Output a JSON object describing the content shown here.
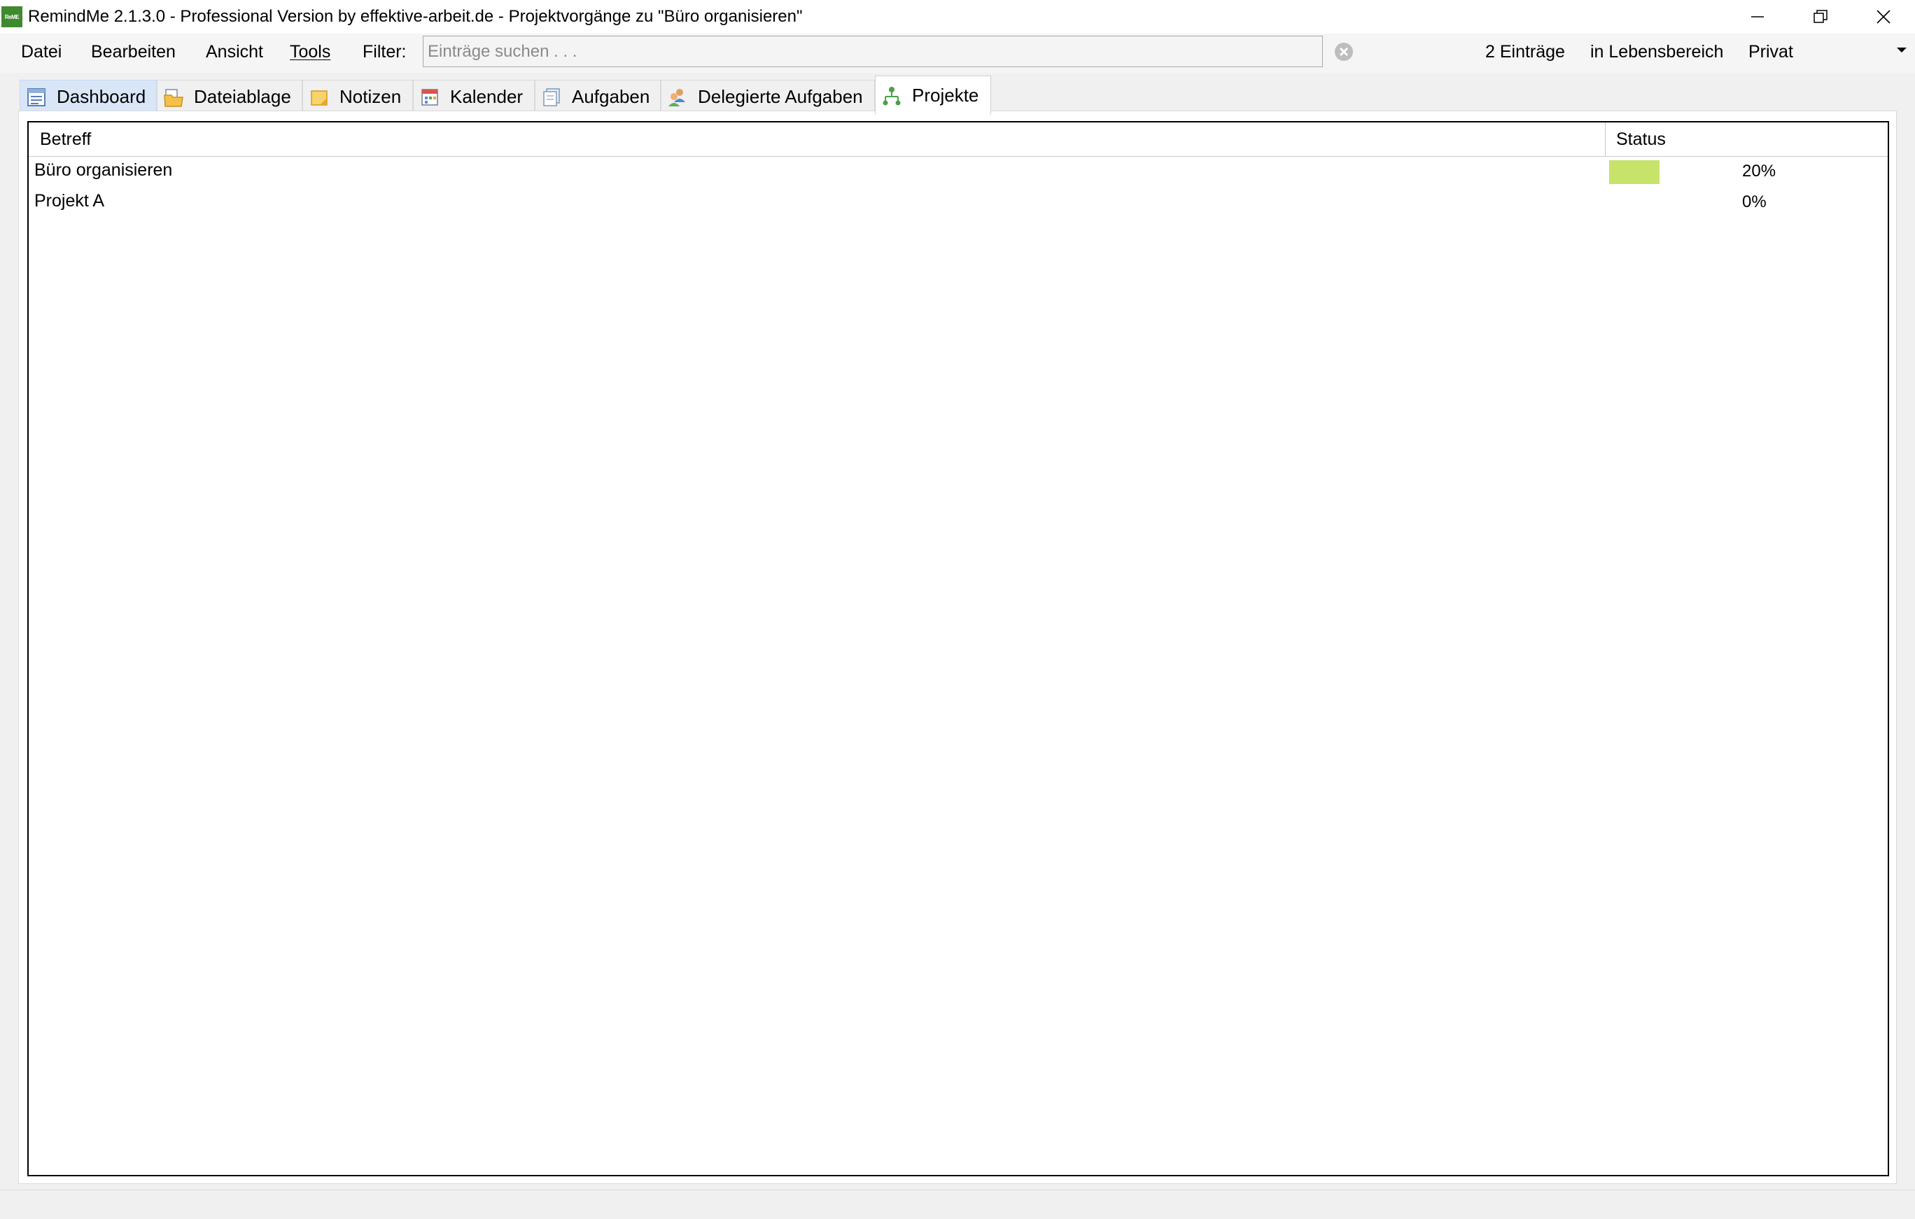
{
  "window": {
    "icon_text": "ReME",
    "title": "RemindMe 2.1.3.0 - Professional Version by effektive-arbeit.de - Projektvorgänge zu \"Büro organisieren\""
  },
  "menu": {
    "items": [
      "Datei",
      "Bearbeiten",
      "Ansicht",
      "Tools"
    ],
    "filter_label": "Filter:",
    "search_placeholder": "Einträge suchen . . .",
    "search_value": ""
  },
  "status": {
    "entries": "2 Einträge",
    "area_label": "in Lebensbereich",
    "area_value": "Privat"
  },
  "tabs": [
    {
      "label": "Dashboard",
      "icon": "dashboard-icon"
    },
    {
      "label": "Dateiablage",
      "icon": "folder-icon"
    },
    {
      "label": "Notizen",
      "icon": "notes-icon"
    },
    {
      "label": "Kalender",
      "icon": "calendar-icon"
    },
    {
      "label": "Aufgaben",
      "icon": "tasks-icon"
    },
    {
      "label": "Delegierte Aufgaben",
      "icon": "delegated-tasks-icon"
    },
    {
      "label": "Projekte",
      "icon": "projects-icon"
    }
  ],
  "active_tab": "Projekte",
  "table": {
    "columns": [
      "Betreff",
      "Status"
    ],
    "rows": [
      {
        "subject": "Büro organisieren",
        "progress": 0.2,
        "progress_label": "20%"
      },
      {
        "subject": "Projekt A",
        "progress": 0.0,
        "progress_label": "0%"
      }
    ]
  },
  "colors": {
    "progress_bar": "#c8e36a",
    "dashboard_tab_bg": "#d9e6f7"
  }
}
